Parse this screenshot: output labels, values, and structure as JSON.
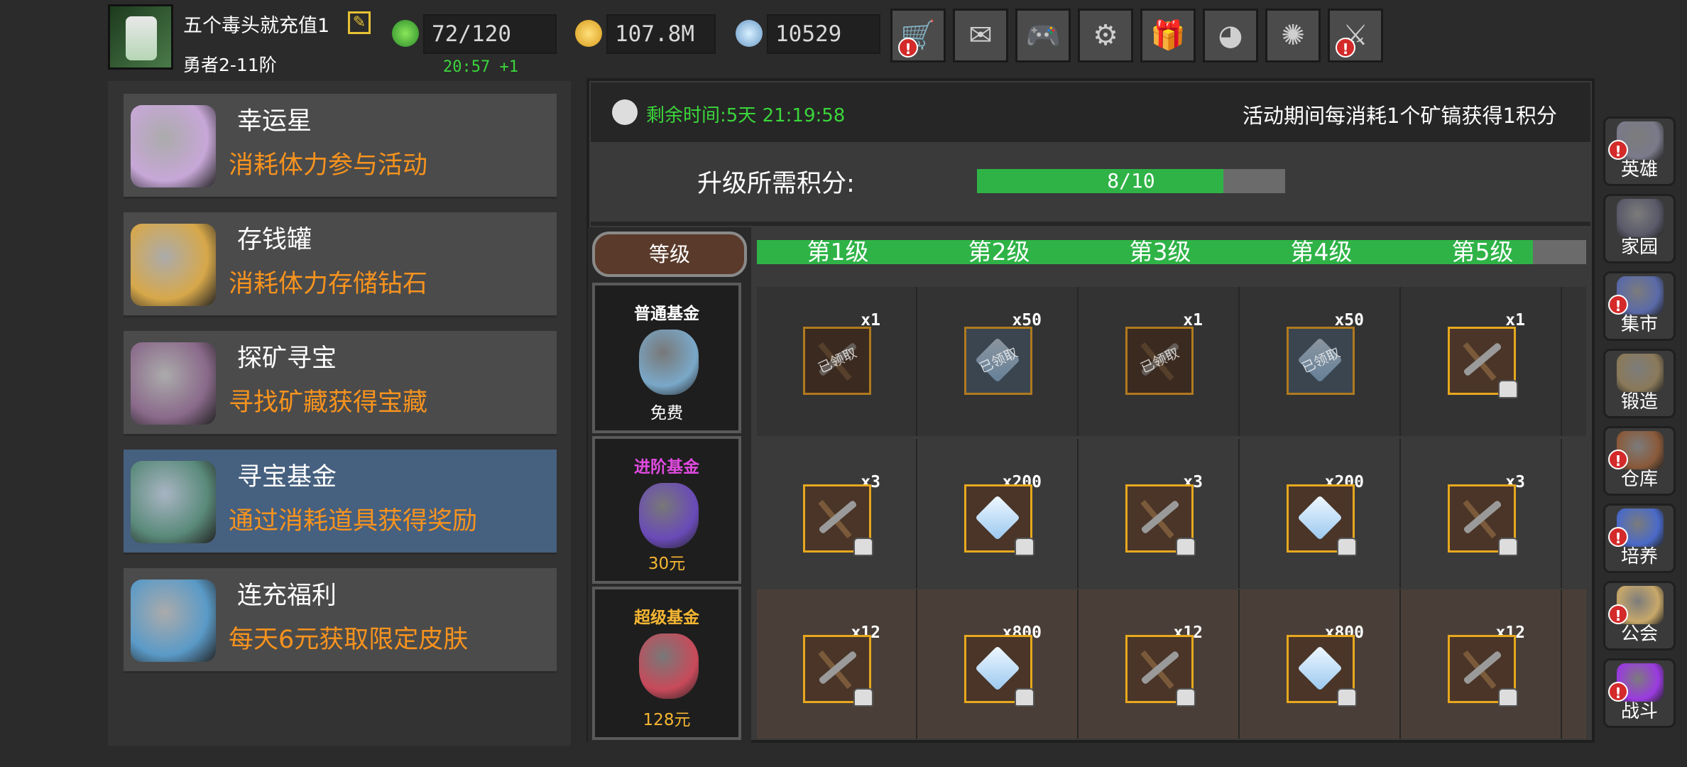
{
  "player": {
    "name": "五个毒头就充值1",
    "rank": "勇者2-11阶"
  },
  "stats": {
    "stamina": "72/120",
    "stamina_timer": "20:57 +1",
    "gold": "107.8M",
    "gems": "10529"
  },
  "top_buttons": [
    {
      "icon": "cart-icon",
      "glyph": "🛒",
      "alert": true
    },
    {
      "icon": "mail-icon",
      "glyph": "✉",
      "alert": false
    },
    {
      "icon": "gamepad-icon",
      "glyph": "🎮",
      "alert": false
    },
    {
      "icon": "gear-icon",
      "glyph": "⚙",
      "alert": false
    },
    {
      "icon": "gift-icon",
      "glyph": "🎁",
      "alert": false
    },
    {
      "icon": "color-wheel-icon",
      "glyph": "◕",
      "alert": false
    },
    {
      "icon": "fireworks-icon",
      "glyph": "✺",
      "alert": false
    },
    {
      "icon": "swords-icon",
      "glyph": "⚔",
      "alert": true
    }
  ],
  "events": [
    {
      "title": "幸运星",
      "desc": "消耗体力参与活动",
      "icon": "lucky-star-icon",
      "color": "#c7a7d7",
      "selected": false
    },
    {
      "title": "存钱罐",
      "desc": "消耗体力存储钻石",
      "icon": "piggy-bank-icon",
      "color": "#d7a84a",
      "selected": false
    },
    {
      "title": "探矿寻宝",
      "desc": "寻找矿藏获得宝藏",
      "icon": "treasure-chest-icon",
      "color": "#8a6a8a",
      "selected": false
    },
    {
      "title": "寻宝基金",
      "desc": "通过消耗道具获得奖励",
      "icon": "treasure-bag-icon",
      "color": "#5a8a7a",
      "selected": true
    },
    {
      "title": "连充福利",
      "desc": "每天6元获取限定皮肤",
      "icon": "crystal-icon",
      "color": "#5a9ac7",
      "selected": false
    }
  ],
  "header": {
    "remaining": "剩余时间:5天  21:19:58",
    "note": "活动期间每消耗1个矿镐获得1积分"
  },
  "points": {
    "label": "升级所需积分:",
    "current": 8,
    "total": 10,
    "text": "8/10"
  },
  "levels": {
    "button": "等级",
    "labels": [
      "第1级",
      "第2级",
      "第3级",
      "第4级",
      "第5级"
    ],
    "progress": 0.936
  },
  "funds": [
    {
      "name": "普通基金",
      "price": "免费",
      "name_color": "#ffffff",
      "price_color": "#ffffff",
      "bag_color": "#7aa8c8"
    },
    {
      "name": "进阶基金",
      "price": "30元",
      "name_color": "#e14be1",
      "price_color": "#f7b733",
      "bag_color": "#6a4ab8"
    },
    {
      "name": "超级基金",
      "price": "128元",
      "name_color": "#f7b733",
      "price_color": "#f7b733",
      "bag_color": "#c84a5a"
    }
  ],
  "rewards": [
    [
      {
        "type": "pickaxe",
        "qty": "x1",
        "claimed": true,
        "locked": false
      },
      {
        "type": "diamond",
        "qty": "x50",
        "claimed": true,
        "locked": false
      },
      {
        "type": "pickaxe",
        "qty": "x1",
        "claimed": true,
        "locked": false
      },
      {
        "type": "diamond",
        "qty": "x50",
        "claimed": true,
        "locked": false
      },
      {
        "type": "pickaxe",
        "qty": "x1",
        "claimed": false,
        "locked": true
      }
    ],
    [
      {
        "type": "pickaxe",
        "qty": "x3",
        "claimed": false,
        "locked": true
      },
      {
        "type": "diamond",
        "qty": "x200",
        "claimed": false,
        "locked": true
      },
      {
        "type": "pickaxe",
        "qty": "x3",
        "claimed": false,
        "locked": true
      },
      {
        "type": "diamond",
        "qty": "x200",
        "claimed": false,
        "locked": true
      },
      {
        "type": "pickaxe",
        "qty": "x3",
        "claimed": false,
        "locked": true
      }
    ],
    [
      {
        "type": "pickaxe",
        "qty": "x12",
        "claimed": false,
        "locked": true
      },
      {
        "type": "diamond",
        "qty": "x800",
        "claimed": false,
        "locked": true
      },
      {
        "type": "pickaxe",
        "qty": "x12",
        "claimed": false,
        "locked": true
      },
      {
        "type": "diamond",
        "qty": "x800",
        "claimed": false,
        "locked": true
      },
      {
        "type": "pickaxe",
        "qty": "x12",
        "claimed": false,
        "locked": true
      }
    ]
  ],
  "claimed_text": "已领取",
  "side_menu": [
    {
      "label": "英雄",
      "icon": "helmet-icon",
      "color": "#7a7a8a",
      "alert": true
    },
    {
      "label": "家园",
      "icon": "castle-icon",
      "color": "#5a5a6a",
      "alert": false
    },
    {
      "label": "集市",
      "icon": "market-icon",
      "color": "#5a6aa8",
      "alert": true
    },
    {
      "label": "锻造",
      "icon": "anvil-icon",
      "color": "#8a7a5a",
      "alert": false
    },
    {
      "label": "仓库",
      "icon": "warehouse-icon",
      "color": "#8a5a3a",
      "alert": true
    },
    {
      "label": "培养",
      "icon": "trophy-icon",
      "color": "#4a6ac8",
      "alert": true
    },
    {
      "label": "公会",
      "icon": "guild-icon",
      "color": "#c8a86a",
      "alert": true
    },
    {
      "label": "战斗",
      "icon": "portal-icon",
      "color": "#9a3ae0",
      "alert": true
    }
  ],
  "colors": {
    "accent_green": "#2fb347",
    "orange_text": "#f7931e",
    "selected_card": "#46607f",
    "alert_red": "#d42a2a"
  }
}
